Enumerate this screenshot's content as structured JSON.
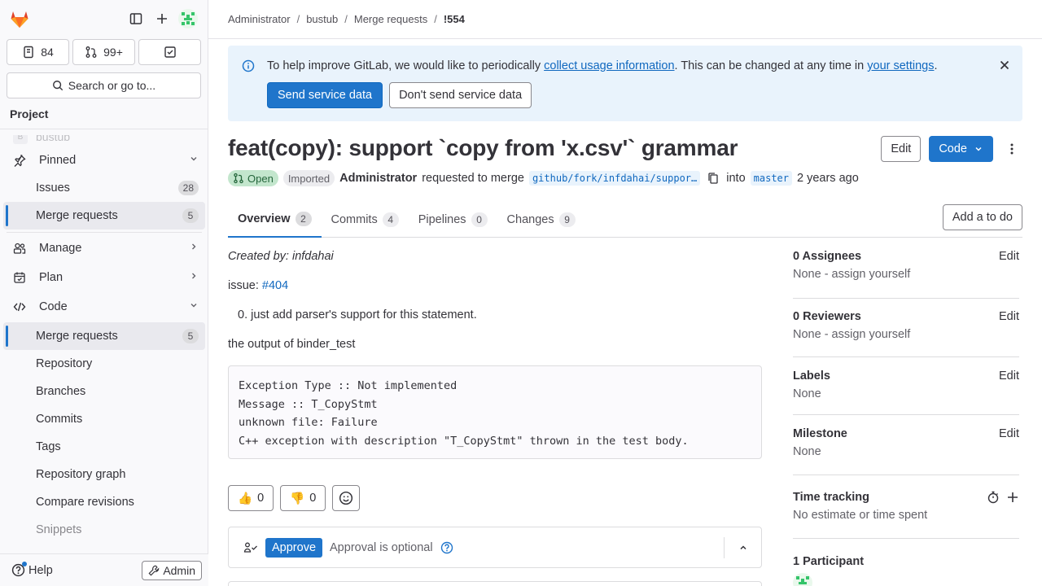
{
  "sidebar": {
    "counts": [
      {
        "icon": "issues-icon",
        "value": "84"
      },
      {
        "icon": "merge-request-icon",
        "value": "99+"
      },
      {
        "icon": "todo-icon",
        "value": ""
      }
    ],
    "search_label": "Search or go to...",
    "section_label": "Project",
    "project_ghost": "bustub",
    "project_initial": "B",
    "pinned_label": "Pinned",
    "pinned_items": [
      {
        "label": "Issues",
        "count": "28"
      },
      {
        "label": "Merge requests",
        "count": "5"
      }
    ],
    "groups": [
      {
        "label": "Manage"
      },
      {
        "label": "Plan"
      },
      {
        "label": "Code"
      }
    ],
    "code_items": [
      {
        "label": "Merge requests",
        "count": "5"
      },
      {
        "label": "Repository"
      },
      {
        "label": "Branches"
      },
      {
        "label": "Commits"
      },
      {
        "label": "Tags"
      },
      {
        "label": "Repository graph"
      },
      {
        "label": "Compare revisions"
      },
      {
        "label": "Snippets"
      }
    ],
    "help_label": "Help",
    "admin_label": "Admin"
  },
  "breadcrumb": [
    "Administrator",
    "bustub",
    "Merge requests",
    "!554"
  ],
  "banner": {
    "text_before": "To help improve GitLab, we would like to periodically ",
    "link1": "collect usage information",
    "text_middle": ". This can be changed at any time in ",
    "link2": "your settings",
    "text_after": ".",
    "send_label": "Send service data",
    "dont_send_label": "Don't send service data"
  },
  "mr": {
    "title": "feat(copy): support `copy from 'x.csv'` grammar",
    "edit_label": "Edit",
    "code_label": "Code",
    "status": "Open",
    "imported": "Imported",
    "author": "Administrator",
    "requested_text": "requested to merge",
    "source_branch": "github/fork/infdahai/suppor…",
    "into_text": "into",
    "target_branch": "master",
    "time_ago": "2 years ago"
  },
  "tabs": [
    {
      "label": "Overview",
      "count": "2"
    },
    {
      "label": "Commits",
      "count": "4"
    },
    {
      "label": "Pipelines",
      "count": "0"
    },
    {
      "label": "Changes",
      "count": "9"
    }
  ],
  "add_todo_label": "Add a to do",
  "description": {
    "created_by": "Created by: infdahai",
    "issue_prefix": "issue: ",
    "issue_link": "#404",
    "list_item": "0. just add parser's support for this statement.",
    "output_label": "the output of binder_test",
    "code_lines": "Exception Type :: Not implemented\nMessage :: T_CopyStmt\nunknown file: Failure\nC++ exception with description \"T_CopyStmt\" thrown in the test body."
  },
  "reactions": [
    {
      "emoji": "👍",
      "count": "0"
    },
    {
      "emoji": "👎",
      "count": "0"
    }
  ],
  "approval": {
    "button": "Approve",
    "text": "Approval is optional"
  },
  "right_sidebar": {
    "assignees": {
      "title": "0 Assignees",
      "value": "None - assign yourself",
      "edit": "Edit"
    },
    "reviewers": {
      "title": "0 Reviewers",
      "value": "None - assign yourself",
      "edit": "Edit"
    },
    "labels": {
      "title": "Labels",
      "value": "None",
      "edit": "Edit"
    },
    "milestone": {
      "title": "Milestone",
      "value": "None",
      "edit": "Edit"
    },
    "time_tracking": {
      "title": "Time tracking",
      "value": "No estimate or time spent"
    },
    "participants": {
      "title": "1 Participant"
    }
  },
  "colors": {
    "accent": "#1f75cb",
    "open_badge": "#c3e6cd",
    "banner_bg": "#e9f3fc"
  }
}
